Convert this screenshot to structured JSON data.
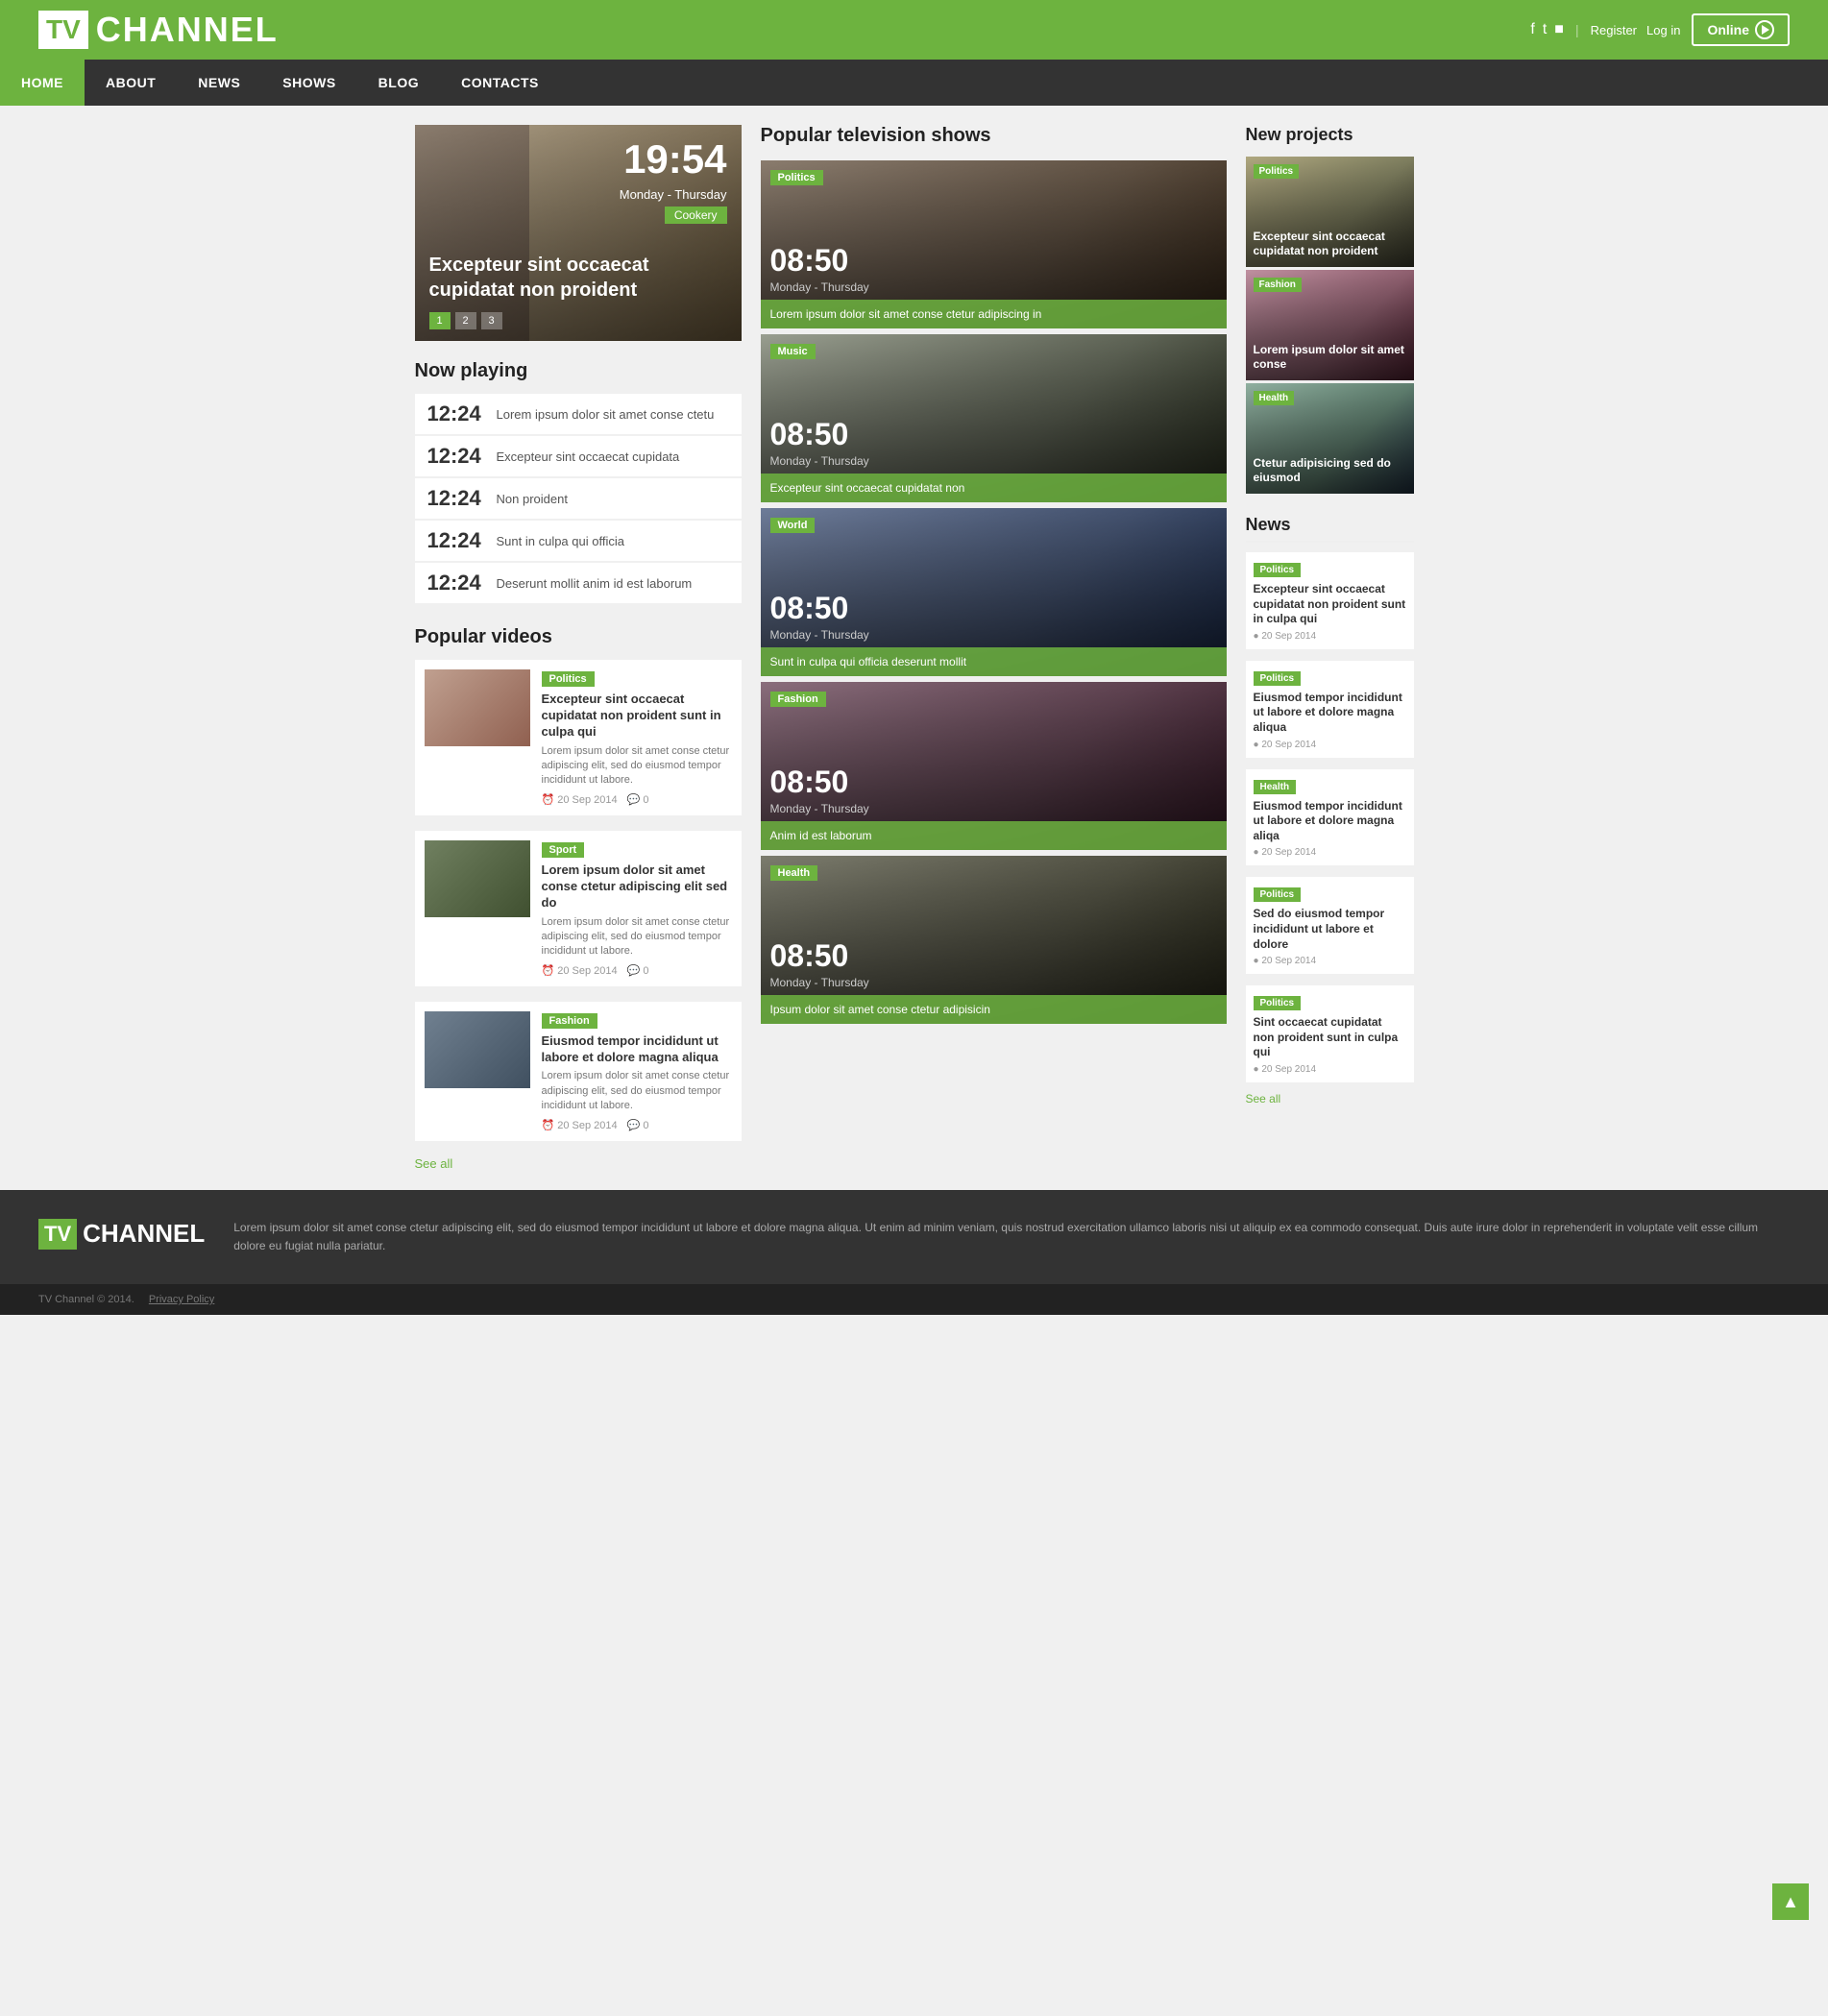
{
  "header": {
    "logo_tv": "TV",
    "logo_channel": "CHANNEL",
    "social": [
      "f",
      "t",
      "rss"
    ],
    "register": "Register",
    "login": "Log in",
    "online": "Online"
  },
  "nav": {
    "items": [
      {
        "label": "HOME",
        "active": true
      },
      {
        "label": "ABOUT",
        "active": false
      },
      {
        "label": "NEWS",
        "active": false
      },
      {
        "label": "SHOWS",
        "active": false
      },
      {
        "label": "BLOG",
        "active": false
      },
      {
        "label": "CONTACTS",
        "active": false
      }
    ]
  },
  "hero": {
    "time": "19:54",
    "schedule": "Monday - Thursday",
    "tag": "Cookery",
    "title": "Excepteur sint occaecat cupidatat non proident",
    "dots": [
      "1",
      "2",
      "3"
    ]
  },
  "now_playing": {
    "section_title": "Now playing",
    "items": [
      {
        "time": "12:24",
        "desc": "Lorem ipsum dolor sit amet conse ctetu"
      },
      {
        "time": "12:24",
        "desc": "Excepteur sint occaecat cupidata"
      },
      {
        "time": "12:24",
        "desc": "Non proident"
      },
      {
        "time": "12:24",
        "desc": "Sunt in culpa qui officia"
      },
      {
        "time": "12:24",
        "desc": "Deserunt mollit anim id est laborum"
      }
    ]
  },
  "popular_videos": {
    "section_title": "Popular videos",
    "items": [
      {
        "tag": "Politics",
        "tag_class": "tag-politics",
        "title": "Excepteur sint occaecat cupidatat non proident sunt in culpa qui",
        "desc": "Lorem ipsum dolor sit amet conse ctetur adipiscing elit, sed do eiusmod tempor incididunt ut labore.",
        "date": "20 Sep 2014",
        "comments": "0",
        "bg": "vid-bg-1"
      },
      {
        "tag": "Sport",
        "tag_class": "tag-sport",
        "title": "Lorem ipsum dolor sit amet conse ctetur adipiscing elit sed do",
        "desc": "Lorem ipsum dolor sit amet conse ctetur adipiscing elit, sed do eiusmod tempor incididunt ut labore.",
        "date": "20 Sep 2014",
        "comments": "0",
        "bg": "vid-bg-2"
      },
      {
        "tag": "Fashion",
        "tag_class": "tag-fashion",
        "title": "Eiusmod tempor incididunt ut labore et dolore magna aliqua",
        "desc": "Lorem ipsum dolor sit amet conse ctetur adipiscing elit, sed do eiusmod tempor incididunt ut labore.",
        "date": "20 Sep 2014",
        "comments": "0",
        "bg": "vid-bg-3"
      }
    ],
    "see_all": "See all"
  },
  "popular_tv": {
    "section_title": "Popular television shows",
    "shows": [
      {
        "tag": "Politics",
        "time": "08:50",
        "schedule": "Monday - Thursday",
        "desc": "Lorem ipsum dolor sit amet conse ctetur adipiscing in",
        "bg": "show-bg-1"
      },
      {
        "tag": "Music",
        "time": "08:50",
        "schedule": "Monday - Thursday",
        "title": "Excepteur sint occaecat cupidatat non",
        "bg": "show-bg-2"
      },
      {
        "tag": "World",
        "time": "08:50",
        "schedule": "Monday - Thursday",
        "title": "Sunt in culpa qui officia deserunt mollit",
        "bg": "show-bg-3"
      },
      {
        "tag": "Fashion",
        "time": "08:50",
        "schedule": "Monday - Thursday",
        "title": "Anim id est laborum",
        "bg": "show-bg-4"
      },
      {
        "tag": "Health",
        "time": "08:50",
        "schedule": "Monday - Thursday",
        "title": "Ipsum dolor sit amet conse ctetur adipisicin",
        "bg": "show-bg-5"
      }
    ]
  },
  "new_projects": {
    "section_title": "New projects",
    "items": [
      {
        "tag": "Politics",
        "title": "Excepteur sint occaecat cupidatat non proident",
        "bg": "proj-bg-1"
      },
      {
        "tag": "Fashion",
        "title": "Lorem ipsum dolor sit amet conse",
        "bg": "proj-bg-2"
      },
      {
        "tag": "Health",
        "title": "Ctetur adipisicing sed do eiusmod",
        "bg": "proj-bg-3"
      }
    ]
  },
  "news": {
    "section_title": "News",
    "items": [
      {
        "tag": "Politics",
        "headline": "Excepteur sint occaecat cupidatat non proident sunt in culpa qui",
        "date": "20 Sep 2014"
      },
      {
        "tag": "Politics",
        "headline": "Eiusmod tempor incididunt ut labore et dolore magna aliqua",
        "date": "20 Sep 2014"
      },
      {
        "tag": "Health",
        "headline": "Eiusmod tempor incididunt ut labore et dolore magna aliqa",
        "date": "20 Sep 2014"
      },
      {
        "tag": "Politics",
        "headline": "Sed do eiusmod tempor incididunt ut labore et dolore",
        "date": "20 Sep 2014"
      },
      {
        "tag": "Politics",
        "headline": "Sint occaecat cupidatat non proident sunt in culpa qui",
        "date": "20 Sep 2014"
      }
    ],
    "see_all": "See all"
  },
  "footer": {
    "logo_tv": "TV",
    "logo_channel": "CHANNEL",
    "description": "Lorem ipsum dolor sit amet conse ctetur adipiscing elit, sed do eiusmod tempor incididunt ut labore et dolore magna aliqua. Ut enim ad minim veniam, quis nostrud exercitation ullamco laboris nisi ut aliquip ex ea commodo consequat. Duis aute irure dolor in reprehenderit in voluptate velit esse cillum dolore eu fugiat nulla pariatur.",
    "copyright": "TV Channel © 2014.",
    "privacy": "Privacy Policy"
  },
  "scroll_top": "▲"
}
